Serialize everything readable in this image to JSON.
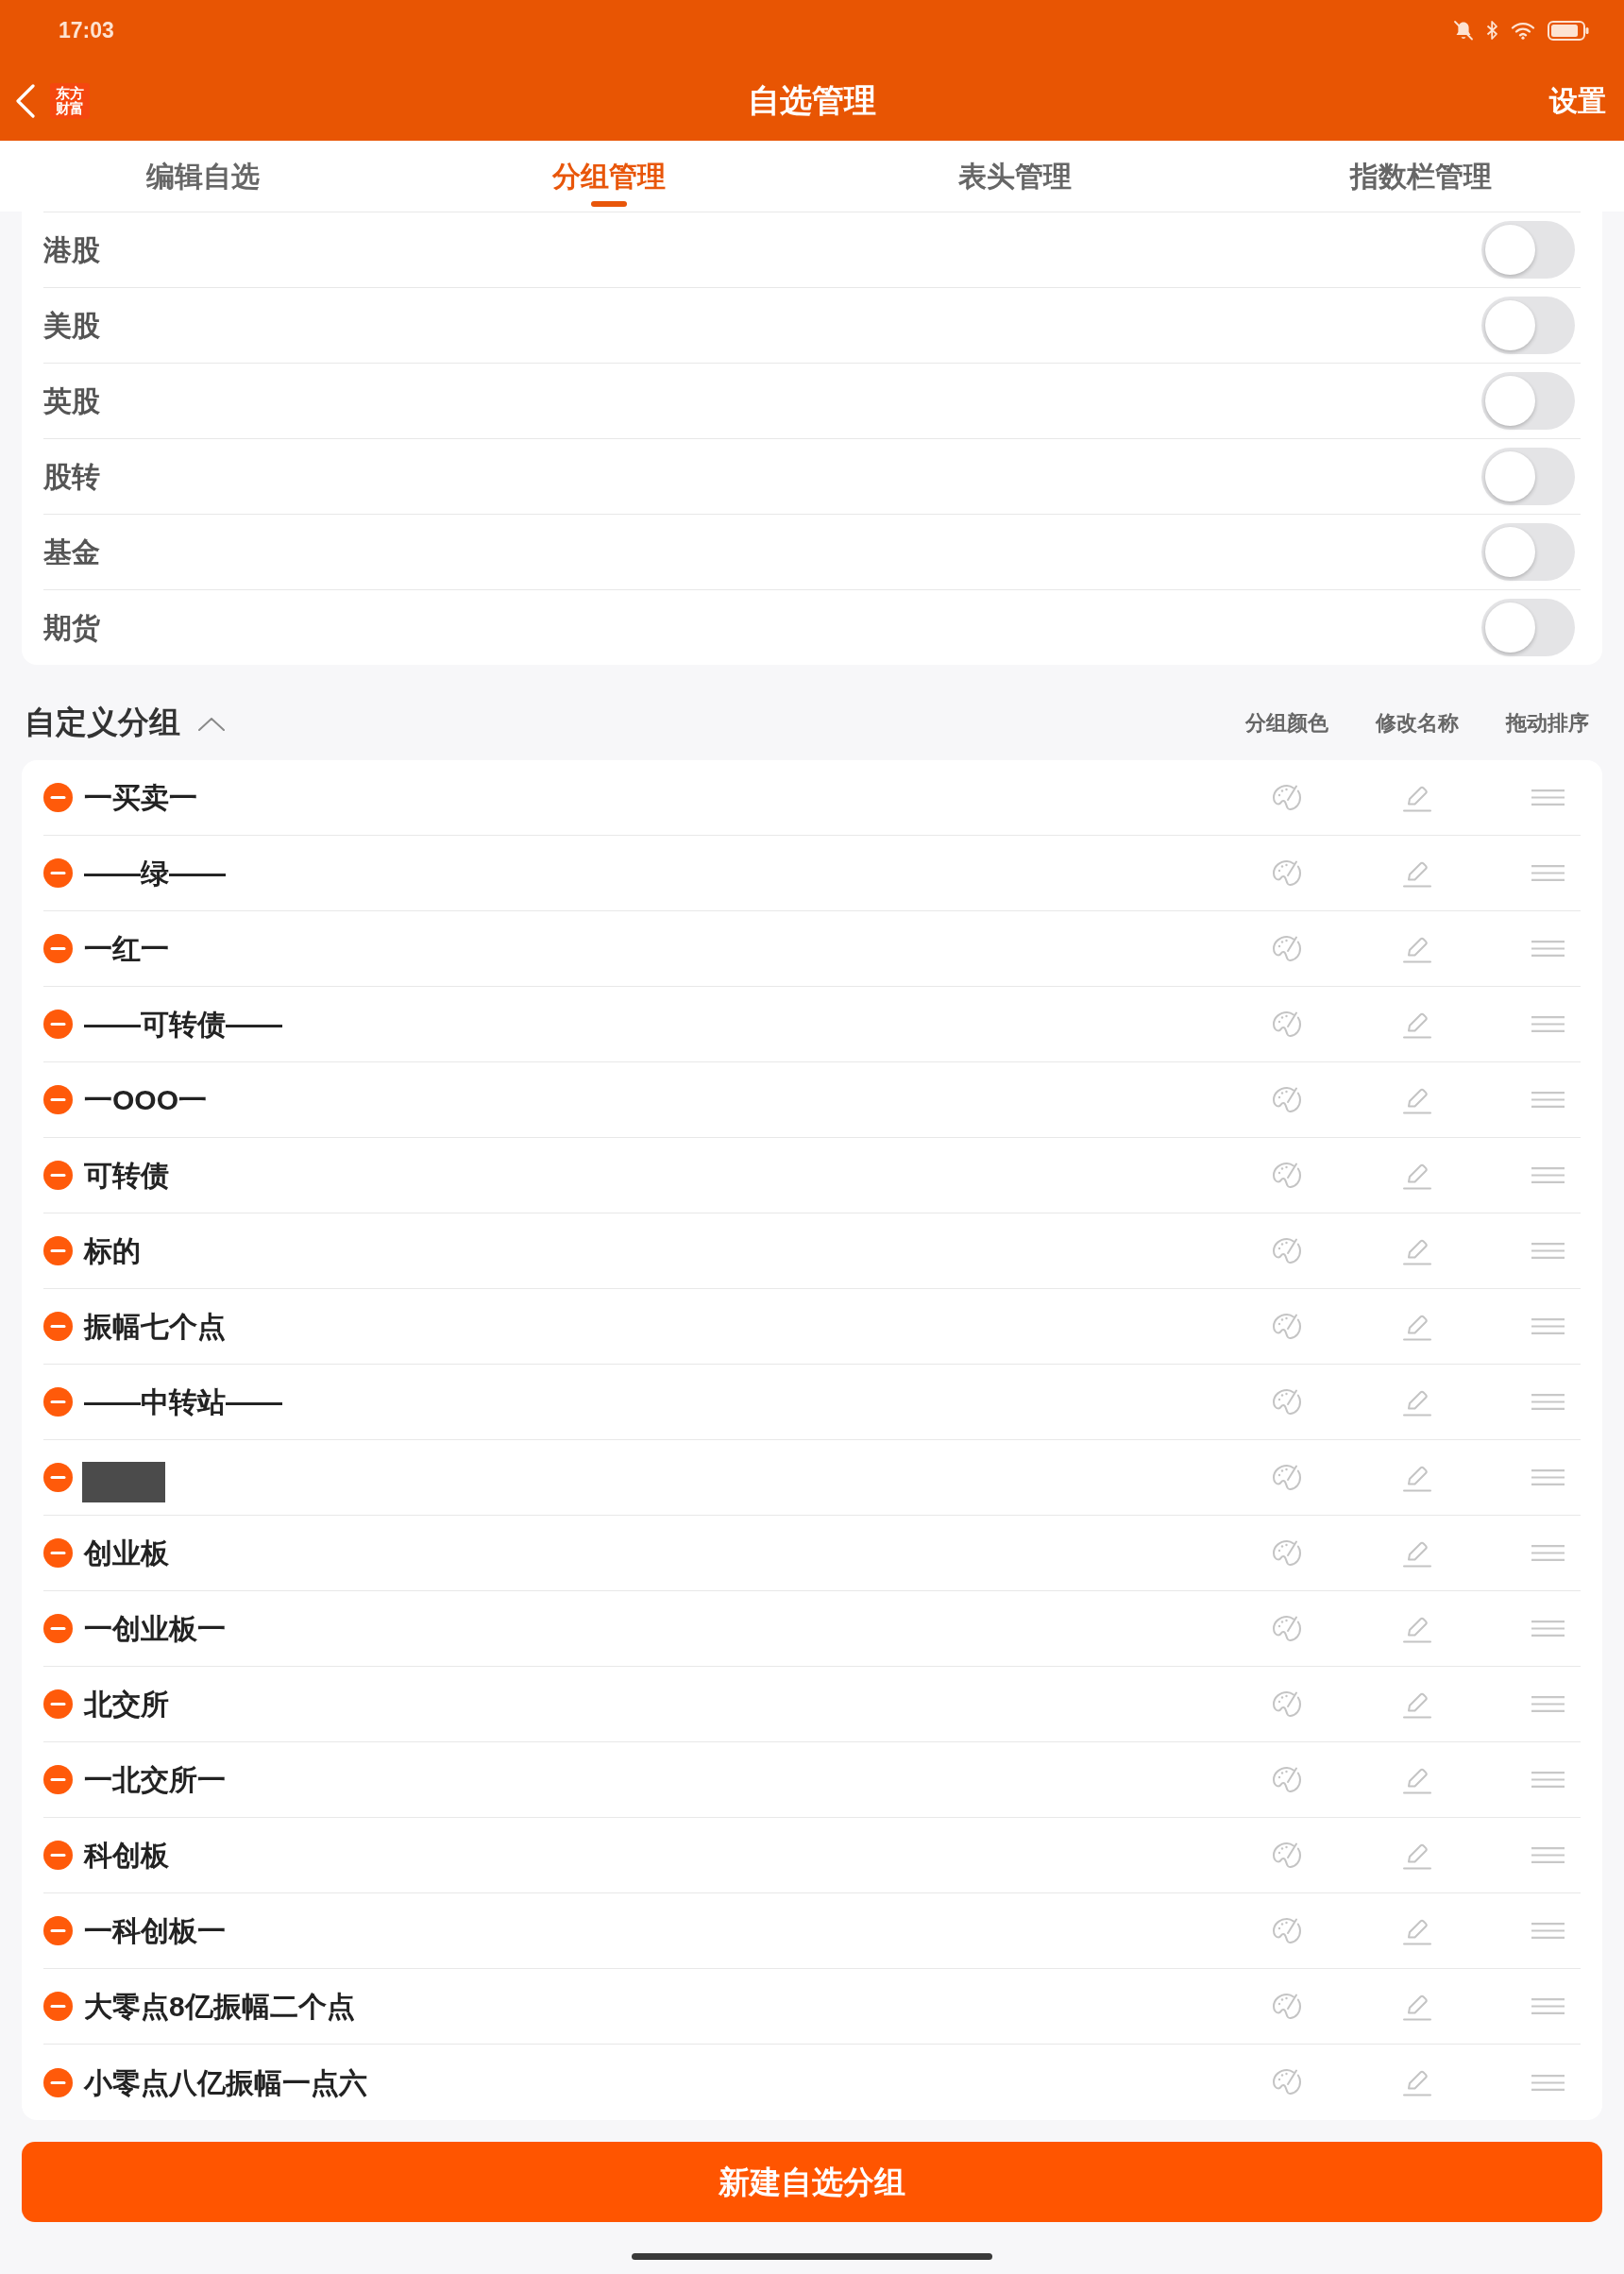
{
  "status_bar": {
    "time": "17:03"
  },
  "nav_bar": {
    "logo_text": "东方财富",
    "title": "自选管理",
    "action": "设置"
  },
  "tabs": [
    {
      "label": "编辑自选",
      "selected": false
    },
    {
      "label": "分组管理",
      "selected": true
    },
    {
      "label": "表头管理",
      "selected": false
    },
    {
      "label": "指数栏管理",
      "selected": false
    }
  ],
  "market_toggles": [
    {
      "label": "港股",
      "on": false
    },
    {
      "label": "美股",
      "on": false
    },
    {
      "label": "英股",
      "on": false
    },
    {
      "label": "股转",
      "on": false
    },
    {
      "label": "基金",
      "on": false
    },
    {
      "label": "期货",
      "on": false
    }
  ],
  "custom_groups": {
    "title": "自定义分组",
    "expanded": true,
    "columns": [
      "分组颜色",
      "修改名称",
      "拖动排序"
    ],
    "items": [
      {
        "kind": "named",
        "name": "一买卖一"
      },
      {
        "kind": "named",
        "name": "——绿——"
      },
      {
        "kind": "named",
        "name": "一红一"
      },
      {
        "kind": "named",
        "name": "——可转债——"
      },
      {
        "kind": "named",
        "name": "一OOO一"
      },
      {
        "kind": "named",
        "name": "可转债"
      },
      {
        "kind": "named",
        "name": "标的"
      },
      {
        "kind": "named",
        "name": "振幅七个点"
      },
      {
        "kind": "named",
        "name": "——中转站——"
      },
      {
        "kind": "redacted"
      },
      {
        "kind": "named",
        "name": "创业板"
      },
      {
        "kind": "named",
        "name": "一创业板一"
      },
      {
        "kind": "named",
        "name": "北交所"
      },
      {
        "kind": "named",
        "name": "一北交所一"
      },
      {
        "kind": "named",
        "name": "科创板"
      },
      {
        "kind": "named",
        "name": "一科创板一"
      },
      {
        "kind": "named",
        "name": "大零点8亿振幅二个点"
      },
      {
        "kind": "named",
        "name": "小零点八亿振幅一点六"
      }
    ]
  },
  "new_group_button": {
    "label": "新建自选分组"
  }
}
